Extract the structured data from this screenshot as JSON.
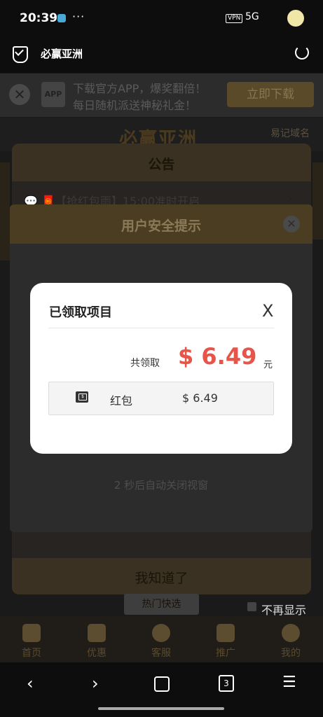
{
  "status": {
    "time": "20:39",
    "dots": "···",
    "vpn": "VPN",
    "right": "5G"
  },
  "browser": {
    "page_title": "必赢亚洲"
  },
  "banner": {
    "line1": "下载官方APP，爆奖翻倍！",
    "line2": "每日随机派送神秘礼金！",
    "app_label": "APP",
    "download_button": "立即下载",
    "close": "✕"
  },
  "site": {
    "logo": "必赢亚洲",
    "domain_hint": "易记域名"
  },
  "notice": {
    "title": "公告",
    "item": "💬 🧧【抢红包雨】15:00准时开启",
    "arrow": "›",
    "footer": "我知道了"
  },
  "security": {
    "title": "用户安全提示",
    "close": "✕",
    "auto_close": "2 秒后自动关闭视窗"
  },
  "claim": {
    "title": "已领取项目",
    "close": "X",
    "total_label": "共领取",
    "total_amount": "$ 6.49",
    "unit": "元",
    "items": [
      {
        "icon": "envelope-icon",
        "name": "红包",
        "amount": "$ 6.49"
      }
    ]
  },
  "below": {
    "hot_quick": "热门快选",
    "no_show": "不再显示"
  },
  "bottom_nav": [
    {
      "label": "首页",
      "icon": "home-icon"
    },
    {
      "label": "优惠",
      "icon": "gift-icon"
    },
    {
      "label": "客服",
      "icon": "headset-icon"
    },
    {
      "label": "推广",
      "icon": "people-icon"
    },
    {
      "label": "我的",
      "icon": "user-icon"
    }
  ],
  "sysnav": {
    "back": "‹",
    "forward": "›",
    "tabs_count": "3",
    "menu": "☰"
  }
}
